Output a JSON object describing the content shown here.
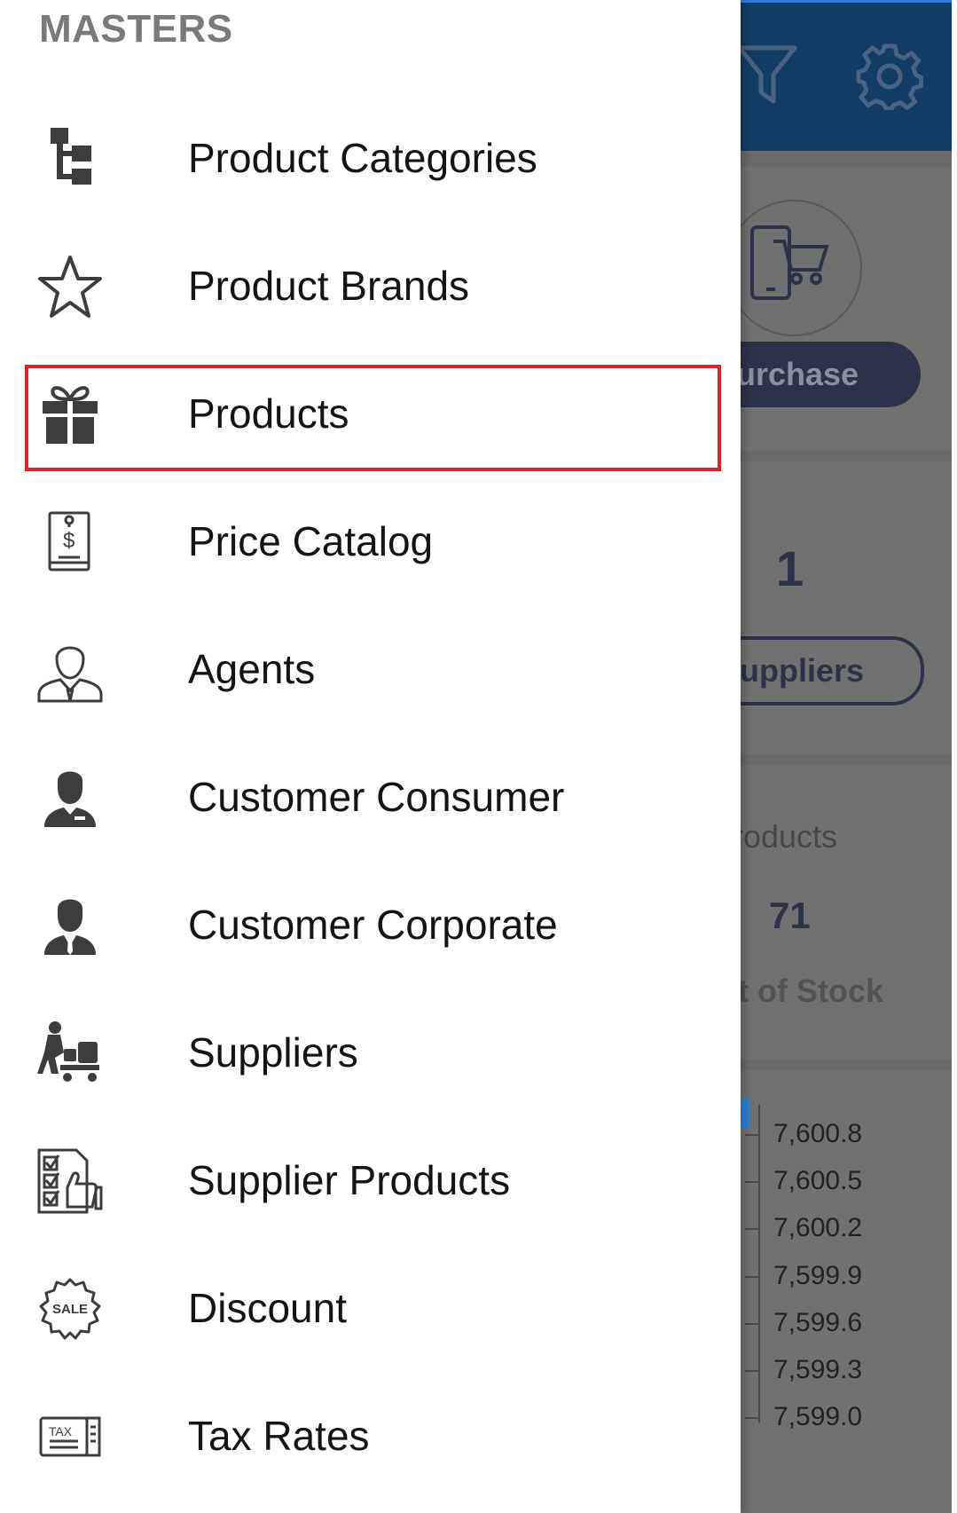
{
  "background": {
    "buttons": {
      "purchase_label": "urchase",
      "suppliers_label": "uppliers"
    },
    "stats": {
      "suppliers_count": "1",
      "products_label": "roducts",
      "products_count": "71",
      "out_of_stock_label": "t of Stock"
    },
    "chart_data": {
      "type": "line",
      "yticks": [
        "7,600.8",
        "7,600.5",
        "7,600.2",
        "7,599.9",
        "7,599.6",
        "7,599.3",
        "7,599.0"
      ],
      "ylim": [
        7599.0,
        7600.8
      ]
    }
  },
  "drawer": {
    "section_title": "MASTERS",
    "items": [
      {
        "label": "Product Categories",
        "icon": "hierarchy-icon"
      },
      {
        "label": "Product Brands",
        "icon": "star-icon"
      },
      {
        "label": "Products",
        "icon": "gift-icon",
        "highlighted": true
      },
      {
        "label": "Price Catalog",
        "icon": "price-tag-book-icon"
      },
      {
        "label": "Agents",
        "icon": "agent-icon"
      },
      {
        "label": "Customer Consumer",
        "icon": "consumer-icon"
      },
      {
        "label": "Customer Corporate",
        "icon": "corporate-icon"
      },
      {
        "label": "Suppliers",
        "icon": "supplier-cart-icon"
      },
      {
        "label": "Supplier Products",
        "icon": "checklist-thumbs-up-icon"
      },
      {
        "label": "Discount",
        "icon": "sale-badge-icon"
      },
      {
        "label": "Tax Rates",
        "icon": "tax-document-icon"
      }
    ]
  },
  "colors": {
    "header_blue": "#123d66",
    "highlight_red": "#e0222b",
    "dark_navy": "#2c3349"
  }
}
